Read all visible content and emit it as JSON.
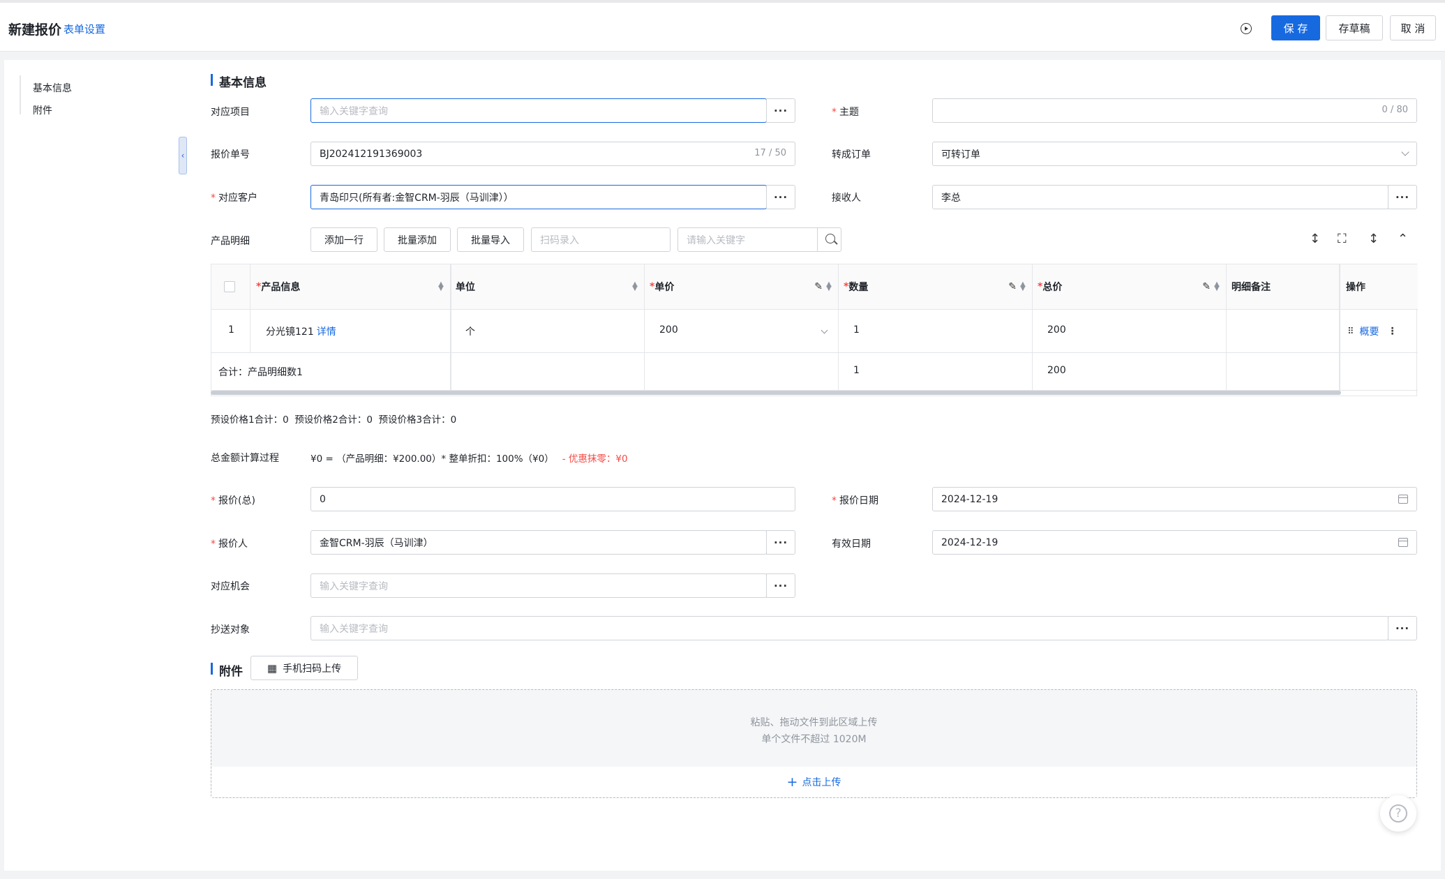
{
  "header": {
    "title": "新建报价",
    "form_settings": "表单设置",
    "save": "保 存",
    "draft": "存草稿",
    "cancel": "取 消"
  },
  "nav": {
    "items": [
      "基本信息",
      "附件"
    ]
  },
  "basic": {
    "section_title": "基本信息",
    "project_label": "对应项目",
    "project_placeholder": "输入关键字查询",
    "subject_label": "主题",
    "subject_counter": "0 / 80",
    "quote_no_label": "报价单号",
    "quote_no_value": "BJ202412191369003",
    "quote_no_counter": "17 / 50",
    "to_order_label": "转成订单",
    "to_order_value": "可转订单",
    "customer_label": "对应客户",
    "customer_value": "青岛印只(所有者:金智CRM-羽辰（马训津））",
    "receiver_label": "接收人",
    "receiver_value": "李总"
  },
  "products": {
    "label": "产品明细",
    "add_row": "添加一行",
    "batch_add": "批量添加",
    "batch_import": "批量导入",
    "scan_placeholder": "扫码录入",
    "keyword_placeholder": "请输入关键字",
    "columns": {
      "product": "产品信息",
      "unit": "单位",
      "price": "单价",
      "qty": "数量",
      "total": "总价",
      "remark": "明细备注",
      "action": "操作"
    },
    "row": {
      "index": "1",
      "product": "分光镜121",
      "detail_link": "详情",
      "unit": "个",
      "price": "200",
      "qty": "1",
      "total": "200",
      "summary_link": "概要"
    },
    "footer": {
      "label": "合计：产品明细数1",
      "qty": "1",
      "total": "200"
    }
  },
  "preset_totals": "预设价格1合计：0  预设价格2合计：0  预设价格3合计：0",
  "calc": {
    "label": "总金额计算过程",
    "formula": "¥0 = （产品明细：¥200.00）* 整单折扣：100%（¥0）",
    "discount": "- 优惠抹零：¥0"
  },
  "quote": {
    "total_label": "报价(总)",
    "total_value": "0",
    "date_label": "报价日期",
    "date_value": "2024-12-19",
    "person_label": "报价人",
    "person_value": "金智CRM-羽辰（马训津）",
    "valid_label": "有效日期",
    "valid_value": "2024-12-19",
    "opportunity_label": "对应机会",
    "opportunity_placeholder": "输入关键字查询",
    "cc_label": "抄送对象",
    "cc_placeholder": "输入关键字查询"
  },
  "attachments": {
    "section_title": "附件",
    "mobile_upload": "手机扫码上传",
    "drop_hint1": "粘贴、拖动文件到此区域上传",
    "drop_hint2": "单个文件不超过 1020M",
    "click_upload": "点击上传"
  },
  "help": {
    "label": "?"
  },
  "colors": {
    "accent": "#1769e0",
    "required": "#f54a45"
  }
}
